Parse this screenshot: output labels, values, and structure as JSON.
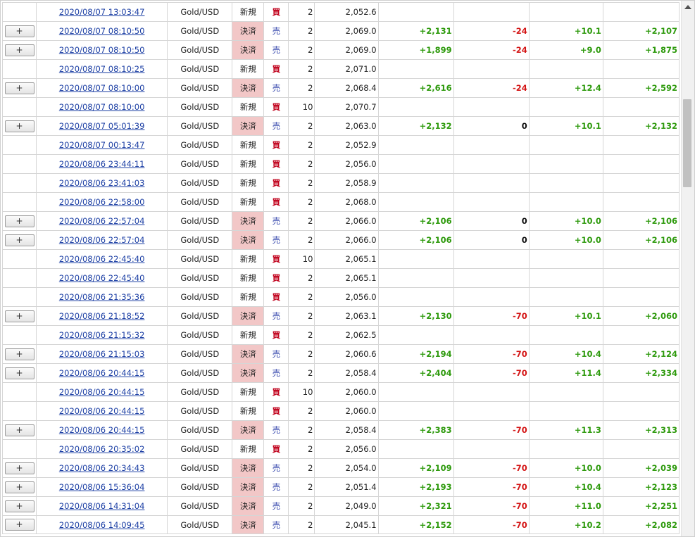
{
  "plus_label": "+",
  "labels": {
    "new": "新規",
    "close": "決済",
    "buy": "買",
    "sell": "売"
  },
  "rows": [
    {
      "btn": false,
      "date": "2020/08/07 13:03:47",
      "symbol": "Gold/USD",
      "type": "新規",
      "side": "買",
      "qty": "2",
      "price": "2,052.6",
      "c1": "",
      "c2": "",
      "c3": "",
      "c4": ""
    },
    {
      "btn": true,
      "date": "2020/08/07 08:10:50",
      "symbol": "Gold/USD",
      "type": "決済",
      "side": "売",
      "qty": "2",
      "price": "2,069.0",
      "c1": "+2,131",
      "c2": "-24",
      "c3": "+10.1",
      "c4": "+2,107"
    },
    {
      "btn": true,
      "date": "2020/08/07 08:10:50",
      "symbol": "Gold/USD",
      "type": "決済",
      "side": "売",
      "qty": "2",
      "price": "2,069.0",
      "c1": "+1,899",
      "c2": "-24",
      "c3": "+9.0",
      "c4": "+1,875"
    },
    {
      "btn": false,
      "date": "2020/08/07 08:10:25",
      "symbol": "Gold/USD",
      "type": "新規",
      "side": "買",
      "qty": "2",
      "price": "2,071.0",
      "c1": "",
      "c2": "",
      "c3": "",
      "c4": ""
    },
    {
      "btn": true,
      "date": "2020/08/07 08:10:00",
      "symbol": "Gold/USD",
      "type": "決済",
      "side": "売",
      "qty": "2",
      "price": "2,068.4",
      "c1": "+2,616",
      "c2": "-24",
      "c3": "+12.4",
      "c4": "+2,592"
    },
    {
      "btn": false,
      "date": "2020/08/07 08:10:00",
      "symbol": "Gold/USD",
      "type": "新規",
      "side": "買",
      "qty": "10",
      "price": "2,070.7",
      "c1": "",
      "c2": "",
      "c3": "",
      "c4": ""
    },
    {
      "btn": true,
      "date": "2020/08/07 05:01:39",
      "symbol": "Gold/USD",
      "type": "決済",
      "side": "売",
      "qty": "2",
      "price": "2,063.0",
      "c1": "+2,132",
      "c2": "0",
      "c3": "+10.1",
      "c4": "+2,132"
    },
    {
      "btn": false,
      "date": "2020/08/07 00:13:47",
      "symbol": "Gold/USD",
      "type": "新規",
      "side": "買",
      "qty": "2",
      "price": "2,052.9",
      "c1": "",
      "c2": "",
      "c3": "",
      "c4": ""
    },
    {
      "btn": false,
      "date": "2020/08/06 23:44:11",
      "symbol": "Gold/USD",
      "type": "新規",
      "side": "買",
      "qty": "2",
      "price": "2,056.0",
      "c1": "",
      "c2": "",
      "c3": "",
      "c4": ""
    },
    {
      "btn": false,
      "date": "2020/08/06 23:41:03",
      "symbol": "Gold/USD",
      "type": "新規",
      "side": "買",
      "qty": "2",
      "price": "2,058.9",
      "c1": "",
      "c2": "",
      "c3": "",
      "c4": ""
    },
    {
      "btn": false,
      "date": "2020/08/06 22:58:00",
      "symbol": "Gold/USD",
      "type": "新規",
      "side": "買",
      "qty": "2",
      "price": "2,068.0",
      "c1": "",
      "c2": "",
      "c3": "",
      "c4": ""
    },
    {
      "btn": true,
      "date": "2020/08/06 22:57:04",
      "symbol": "Gold/USD",
      "type": "決済",
      "side": "売",
      "qty": "2",
      "price": "2,066.0",
      "c1": "+2,106",
      "c2": "0",
      "c3": "+10.0",
      "c4": "+2,106"
    },
    {
      "btn": true,
      "date": "2020/08/06 22:57:04",
      "symbol": "Gold/USD",
      "type": "決済",
      "side": "売",
      "qty": "2",
      "price": "2,066.0",
      "c1": "+2,106",
      "c2": "0",
      "c3": "+10.0",
      "c4": "+2,106"
    },
    {
      "btn": false,
      "date": "2020/08/06 22:45:40",
      "symbol": "Gold/USD",
      "type": "新規",
      "side": "買",
      "qty": "10",
      "price": "2,065.1",
      "c1": "",
      "c2": "",
      "c3": "",
      "c4": ""
    },
    {
      "btn": false,
      "date": "2020/08/06 22:45:40",
      "symbol": "Gold/USD",
      "type": "新規",
      "side": "買",
      "qty": "2",
      "price": "2,065.1",
      "c1": "",
      "c2": "",
      "c3": "",
      "c4": ""
    },
    {
      "btn": false,
      "date": "2020/08/06 21:35:36",
      "symbol": "Gold/USD",
      "type": "新規",
      "side": "買",
      "qty": "2",
      "price": "2,056.0",
      "c1": "",
      "c2": "",
      "c3": "",
      "c4": ""
    },
    {
      "btn": true,
      "date": "2020/08/06 21:18:52",
      "symbol": "Gold/USD",
      "type": "決済",
      "side": "売",
      "qty": "2",
      "price": "2,063.1",
      "c1": "+2,130",
      "c2": "-70",
      "c3": "+10.1",
      "c4": "+2,060"
    },
    {
      "btn": false,
      "date": "2020/08/06 21:15:32",
      "symbol": "Gold/USD",
      "type": "新規",
      "side": "買",
      "qty": "2",
      "price": "2,062.5",
      "c1": "",
      "c2": "",
      "c3": "",
      "c4": ""
    },
    {
      "btn": true,
      "date": "2020/08/06 21:15:03",
      "symbol": "Gold/USD",
      "type": "決済",
      "side": "売",
      "qty": "2",
      "price": "2,060.6",
      "c1": "+2,194",
      "c2": "-70",
      "c3": "+10.4",
      "c4": "+2,124"
    },
    {
      "btn": true,
      "date": "2020/08/06 20:44:15",
      "symbol": "Gold/USD",
      "type": "決済",
      "side": "売",
      "qty": "2",
      "price": "2,058.4",
      "c1": "+2,404",
      "c2": "-70",
      "c3": "+11.4",
      "c4": "+2,334"
    },
    {
      "btn": false,
      "date": "2020/08/06 20:44:15",
      "symbol": "Gold/USD",
      "type": "新規",
      "side": "買",
      "qty": "10",
      "price": "2,060.0",
      "c1": "",
      "c2": "",
      "c3": "",
      "c4": ""
    },
    {
      "btn": false,
      "date": "2020/08/06 20:44:15",
      "symbol": "Gold/USD",
      "type": "新規",
      "side": "買",
      "qty": "2",
      "price": "2,060.0",
      "c1": "",
      "c2": "",
      "c3": "",
      "c4": ""
    },
    {
      "btn": true,
      "date": "2020/08/06 20:44:15",
      "symbol": "Gold/USD",
      "type": "決済",
      "side": "売",
      "qty": "2",
      "price": "2,058.4",
      "c1": "+2,383",
      "c2": "-70",
      "c3": "+11.3",
      "c4": "+2,313"
    },
    {
      "btn": false,
      "date": "2020/08/06 20:35:02",
      "symbol": "Gold/USD",
      "type": "新規",
      "side": "買",
      "qty": "2",
      "price": "2,056.0",
      "c1": "",
      "c2": "",
      "c3": "",
      "c4": ""
    },
    {
      "btn": true,
      "date": "2020/08/06 20:34:43",
      "symbol": "Gold/USD",
      "type": "決済",
      "side": "売",
      "qty": "2",
      "price": "2,054.0",
      "c1": "+2,109",
      "c2": "-70",
      "c3": "+10.0",
      "c4": "+2,039"
    },
    {
      "btn": true,
      "date": "2020/08/06 15:36:04",
      "symbol": "Gold/USD",
      "type": "決済",
      "side": "売",
      "qty": "2",
      "price": "2,051.4",
      "c1": "+2,193",
      "c2": "-70",
      "c3": "+10.4",
      "c4": "+2,123"
    },
    {
      "btn": true,
      "date": "2020/08/06 14:31:04",
      "symbol": "Gold/USD",
      "type": "決済",
      "side": "売",
      "qty": "2",
      "price": "2,049.0",
      "c1": "+2,321",
      "c2": "-70",
      "c3": "+11.0",
      "c4": "+2,251"
    },
    {
      "btn": true,
      "date": "2020/08/06 14:09:45",
      "symbol": "Gold/USD",
      "type": "決済",
      "side": "売",
      "qty": "2",
      "price": "2,045.1",
      "c1": "+2,152",
      "c2": "-70",
      "c3": "+10.2",
      "c4": "+2,082"
    }
  ],
  "colors": {
    "positive": "#2e9a0d",
    "negative": "#d41616",
    "close_bg": "#f2c7c7",
    "buy": "#c0001b",
    "sell": "#2c3fa9",
    "link": "#1c3fa4"
  },
  "scrollbar": {
    "position": 0.19
  }
}
